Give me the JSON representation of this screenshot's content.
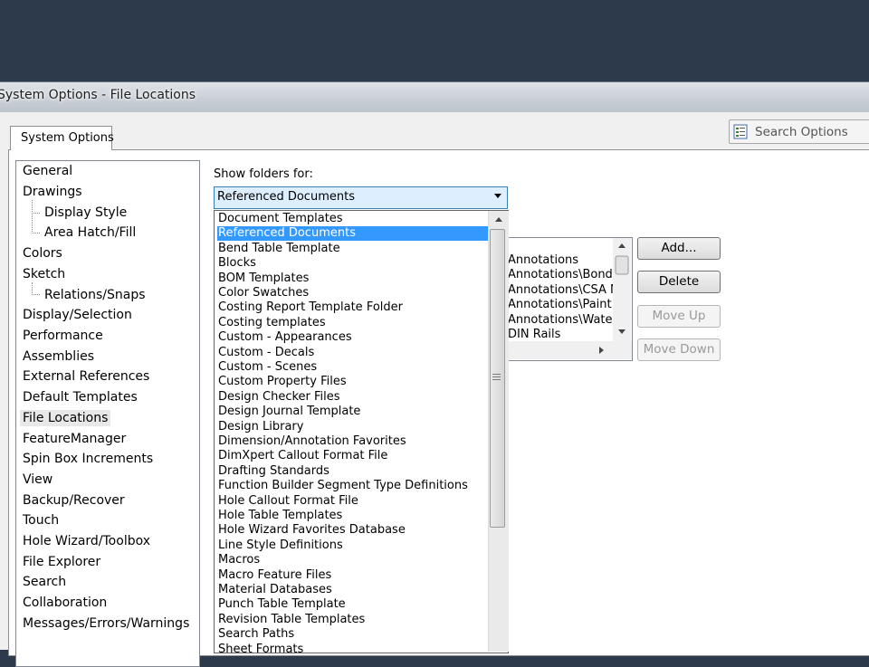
{
  "window": {
    "title": "System Options - File Locations"
  },
  "tabs": [
    {
      "label": "System Options"
    }
  ],
  "search": {
    "label": "Search Options",
    "icon": "search-options-icon"
  },
  "tree": {
    "items": [
      {
        "label": "General"
      },
      {
        "label": "Drawings"
      },
      {
        "label": "Display Style"
      },
      {
        "label": "Area Hatch/Fill"
      },
      {
        "label": "Colors"
      },
      {
        "label": "Sketch"
      },
      {
        "label": "Relations/Snaps"
      },
      {
        "label": "Display/Selection"
      },
      {
        "label": "Performance"
      },
      {
        "label": "Assemblies"
      },
      {
        "label": "External References"
      },
      {
        "label": "Default Templates"
      },
      {
        "label": "File Locations"
      },
      {
        "label": "FeatureManager"
      },
      {
        "label": "Spin Box Increments"
      },
      {
        "label": "View"
      },
      {
        "label": "Backup/Recover"
      },
      {
        "label": "Touch"
      },
      {
        "label": "Hole Wizard/Toolbox"
      },
      {
        "label": "File Explorer"
      },
      {
        "label": "Search"
      },
      {
        "label": "Collaboration"
      },
      {
        "label": "Messages/Errors/Warnings"
      }
    ]
  },
  "show_folders": {
    "label": "Show folders for:",
    "selected": "Referenced Documents"
  },
  "dropdown": {
    "options": [
      {
        "label": "Document Templates"
      },
      {
        "label": "Referenced Documents"
      },
      {
        "label": "Bend Table Template"
      },
      {
        "label": "Blocks"
      },
      {
        "label": "BOM Templates"
      },
      {
        "label": "Color Swatches"
      },
      {
        "label": "Costing Report Template Folder"
      },
      {
        "label": "Costing templates"
      },
      {
        "label": "Custom - Appearances"
      },
      {
        "label": "Custom - Decals"
      },
      {
        "label": "Custom - Scenes"
      },
      {
        "label": "Custom Property Files"
      },
      {
        "label": "Design Checker Files"
      },
      {
        "label": "Design Journal Template"
      },
      {
        "label": "Design Library"
      },
      {
        "label": "Dimension/Annotation Favorites"
      },
      {
        "label": "DimXpert Callout Format File"
      },
      {
        "label": "Drafting Standards"
      },
      {
        "label": "Function Builder Segment Type Definitions"
      },
      {
        "label": "Hole Callout Format File"
      },
      {
        "label": "Hole Table Templates"
      },
      {
        "label": "Hole Wizard Favorites Database"
      },
      {
        "label": "Line Style Definitions"
      },
      {
        "label": "Macros"
      },
      {
        "label": "Macro Feature Files"
      },
      {
        "label": "Material Databases"
      },
      {
        "label": "Punch Table Template"
      },
      {
        "label": "Revision Table Templates"
      },
      {
        "label": "Search Paths"
      },
      {
        "label": "Sheet Formats"
      }
    ]
  },
  "folders": {
    "items": [
      {
        "label": "Annotations"
      },
      {
        "label": "Annotations\\Bonding"
      },
      {
        "label": "Annotations\\CSA N"
      },
      {
        "label": "Annotations\\Paint I"
      },
      {
        "label": "Annotations\\Water"
      },
      {
        "label": "DIN Rails"
      }
    ]
  },
  "buttons": {
    "add": "Add...",
    "delete": "Delete",
    "move_up": "Move Up",
    "move_down": "Move Down"
  },
  "colors": {
    "highlight": "#3399ff",
    "combo_bg": "#ddeeff",
    "desktop": "#2c3a4c"
  }
}
